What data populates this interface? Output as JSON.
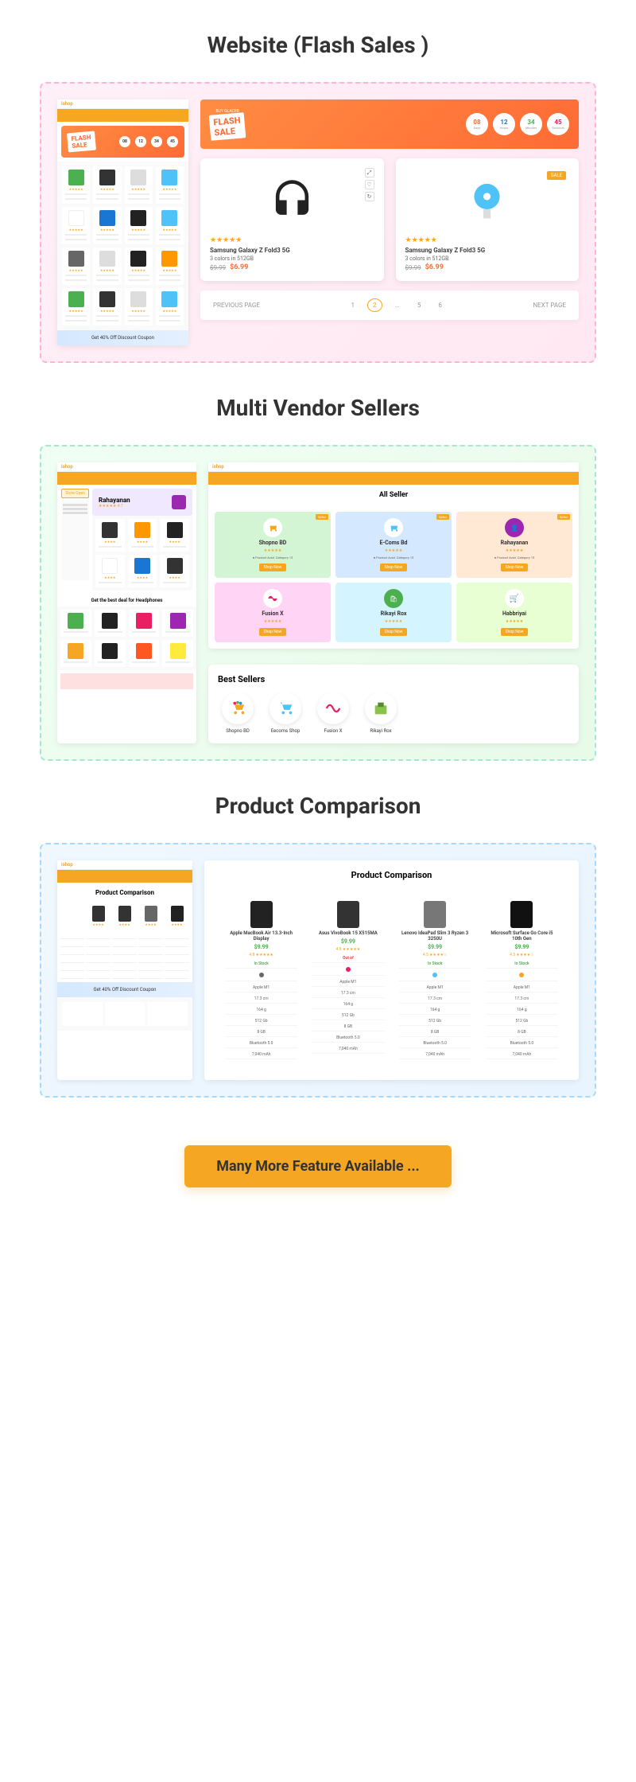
{
  "sections": {
    "flash": "Website (Flash Sales )",
    "vendor": "Multi Vendor Sellers",
    "comparison": "Product Comparison"
  },
  "logo": "ishop",
  "flash_sale": {
    "badge_top": "BUY GLACER",
    "badge": "FLASH",
    "badge2": "SALE",
    "countdown": [
      {
        "num": "08",
        "label": "Days"
      },
      {
        "num": "12",
        "label": "Hours"
      },
      {
        "num": "34",
        "label": "Minutes"
      },
      {
        "num": "45",
        "label": "Seconds"
      }
    ]
  },
  "product1": {
    "title": "Samsung Galaxy Z Fold3 5G",
    "sub": "3 colors in 512GB",
    "old": "$9.99",
    "new": "$6.99"
  },
  "product2": {
    "sale": "SALE",
    "title": "Samsung Galaxy Z Fold3 5G",
    "sub": "3 colors in 512GB",
    "old": "$9.99",
    "new": "$6.99"
  },
  "pagination": {
    "prev": "PREVIOUS PAGE",
    "pages": [
      "1",
      "2",
      "...",
      "5",
      "6"
    ],
    "next": "NEXT PAGE"
  },
  "store": {
    "open_badge": "Store Open",
    "name": "Rahayanan",
    "rating": "4.7"
  },
  "all_seller": "All Seller",
  "sellers": [
    {
      "name": "Shopno BD",
      "color": "#d4f5d4"
    },
    {
      "name": "E-Coms Bd",
      "color": "#d4e8ff"
    },
    {
      "name": "Rahayanan",
      "color": "#ffe8d4"
    },
    {
      "name": "Fusion X",
      "color": "#ffd4f5"
    },
    {
      "name": "Rikayi Rox",
      "color": "#d4f5ff"
    },
    {
      "name": "Habbriyai",
      "color": "#e8ffd4"
    }
  ],
  "best_sellers_title": "Best Sellers",
  "best_sellers": [
    "Shopno BD",
    "Eecoms Shop",
    "Fusion X",
    "Rikayi Rox"
  ],
  "comp_title": "Product Comparison",
  "comp_products": [
    {
      "name": "Apple MacBook Air 13.3-Inch Display",
      "price": "$9.99",
      "rating": "4.8"
    },
    {
      "name": "Asus VivoBook 15 X515MA",
      "price": "$9.99",
      "rating": "4.8"
    },
    {
      "name": "Lenovo IdeaPad Slim 3 Ryzen 3 3250U",
      "price": "$9.99",
      "rating": "4.5"
    },
    {
      "name": "Microsoft Surface Go Core i5 10th Gen",
      "price": "$9.99",
      "rating": "4.5"
    }
  ],
  "comp_rows": [
    "In Stock",
    "Apple M1",
    "17.3 cm",
    "164 g",
    "512 Gb",
    "8 GB",
    "Bluetooth 5.0",
    "7,040 mAh"
  ],
  "discount": "Get 40% Off Discount Coupon",
  "cta": "Many More Feature Available ..."
}
